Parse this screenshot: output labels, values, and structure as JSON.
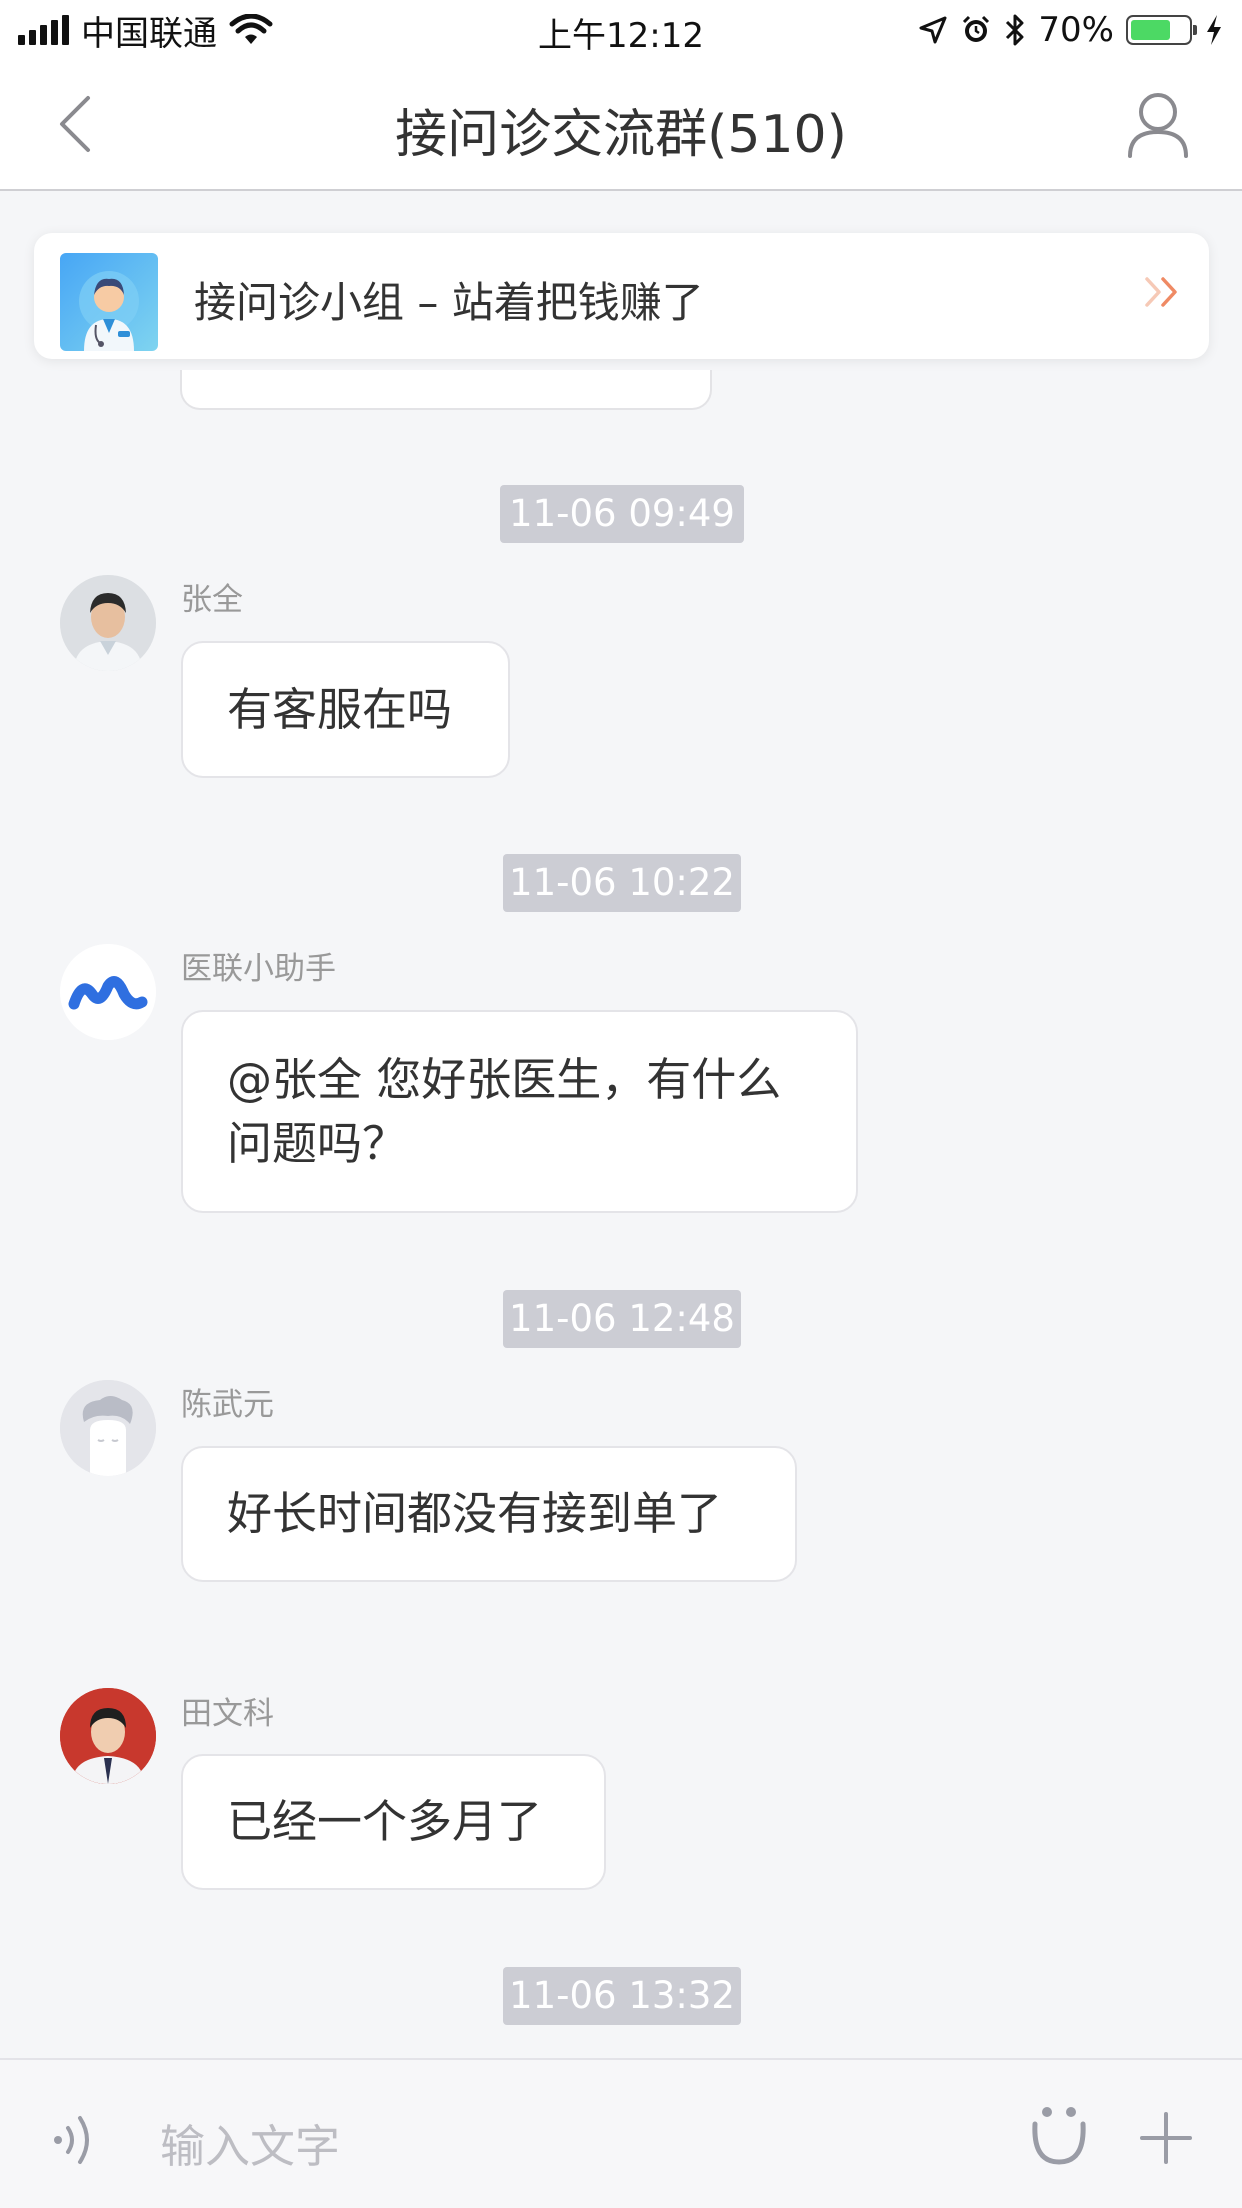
{
  "status_bar": {
    "carrier": "中国联通",
    "time": "上午12:12",
    "battery": "70%",
    "battery_level": 0.7
  },
  "nav": {
    "title": "接问诊交流群(510)"
  },
  "banner": {
    "text": "接问诊小组 – 站着把钱赚了"
  },
  "messages": [
    {
      "timestamp": "11-06 09:49",
      "sender": "张全",
      "text": "有客服在吗"
    },
    {
      "timestamp": "11-06 10:22",
      "sender": "医联小助手",
      "text_line1": "@张全 您好张医生，有什么",
      "text_line2": "问题吗？"
    },
    {
      "timestamp": "11-06 12:48",
      "sender": "陈武元",
      "text": "好长时间都没有接到单了"
    },
    {
      "sender": "田文科",
      "text": "已经一个多月了"
    }
  ],
  "trailing_timestamp": "11-06 13:32",
  "input": {
    "placeholder": "输入文字"
  },
  "colors": {
    "background": "#f5f6f8",
    "timestamp_bg": "#cccdd4",
    "battery": "#4cd964",
    "assistant_logo": "#2f6fe0"
  }
}
